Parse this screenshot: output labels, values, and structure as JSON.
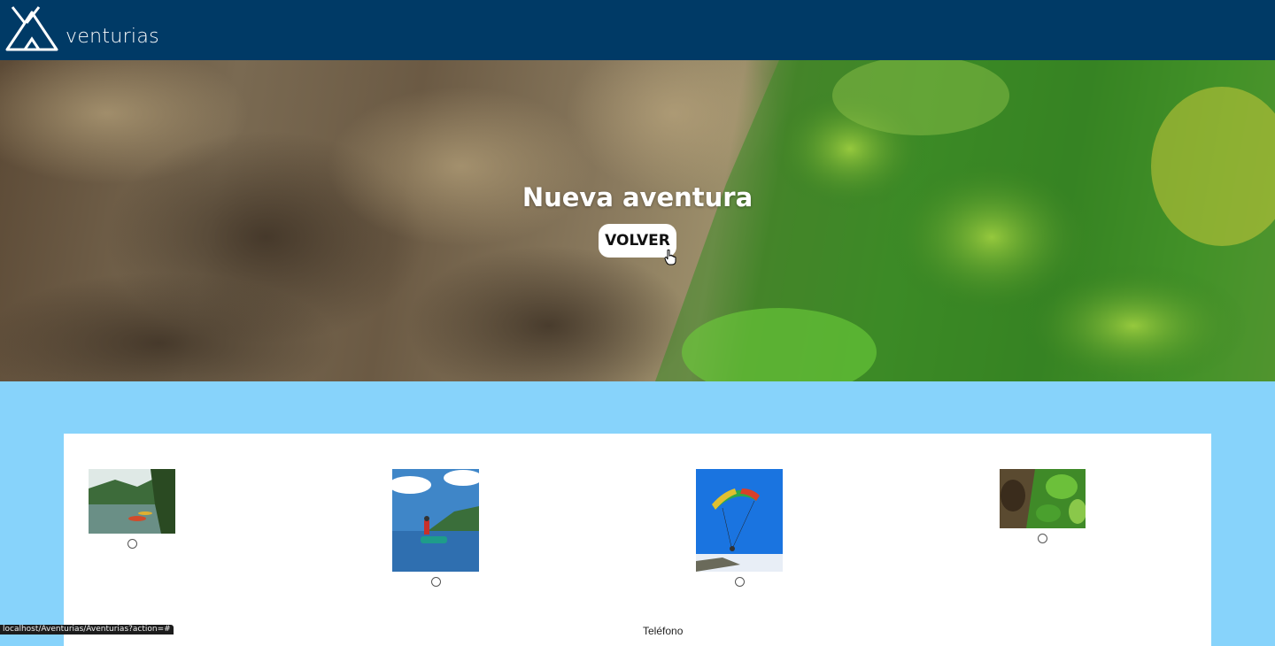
{
  "brand": {
    "name": "venturias",
    "logo_icon": "tent-icon",
    "navbar_color": "#003a66"
  },
  "hero": {
    "title": "Nueva aventura",
    "back_button_label": "VOLVER"
  },
  "adventure_options": [
    {
      "image": "kayak-river-photo"
    },
    {
      "image": "jetski-lake-photo"
    },
    {
      "image": "paragliding-sky-photo"
    },
    {
      "image": "canyon-forest-photo"
    }
  ],
  "form": {
    "phone_label": "Teléfono"
  },
  "status_bar": {
    "url": "localhost/Aventurias/Aventurias?action=#"
  },
  "colors": {
    "page_background": "#87d3fb",
    "panel_background": "#ffffff"
  }
}
